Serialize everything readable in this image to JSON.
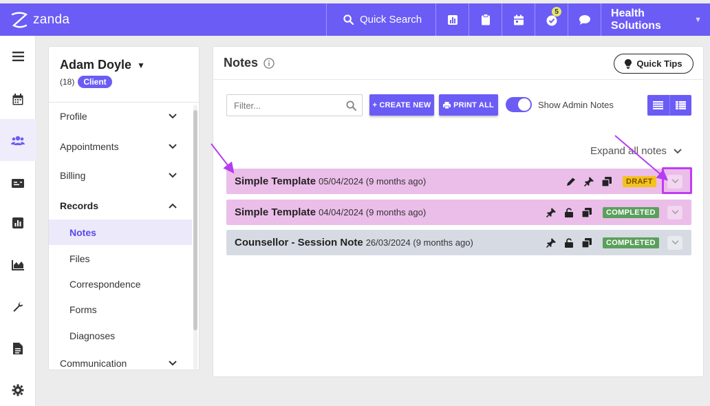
{
  "brand": {
    "name": "zanda",
    "accent": "#6b5cf6"
  },
  "topbar": {
    "search_label": "Quick Search",
    "icons": [
      "chart-icon",
      "clipboard-icon",
      "calendar-icon",
      "task-check-icon",
      "chat-icon"
    ],
    "task_badge": "5",
    "org_name": "Health Solutions"
  },
  "rail": {
    "items": [
      "menu-icon",
      "calendar-icon",
      "clients-icon",
      "billing-card-icon",
      "reports-icon",
      "analytics-icon",
      "tools-icon",
      "documents-icon",
      "settings-icon"
    ],
    "active": "clients-icon"
  },
  "client": {
    "name": "Adam Doyle",
    "count": "(18)",
    "type": "Client"
  },
  "side_menu": {
    "sections": [
      {
        "label": "Profile",
        "state": "collapsed"
      },
      {
        "label": "Appointments",
        "state": "collapsed"
      },
      {
        "label": "Billing",
        "state": "collapsed"
      },
      {
        "label": "Records",
        "state": "expanded"
      }
    ],
    "records_items": [
      "Notes",
      "Files",
      "Correspondence",
      "Forms",
      "Diagnoses"
    ],
    "active_item": "Notes",
    "communication": "Communication"
  },
  "main": {
    "title": "Notes",
    "quick_tips": "Quick Tips",
    "filter_placeholder": "Filter...",
    "create_new": "+ CREATE NEW",
    "print_all": "PRINT ALL",
    "show_admin_notes_label": "Show Admin Notes",
    "show_admin_notes_on": true,
    "expand_all": "Expand all notes"
  },
  "notes": [
    {
      "title": "Simple Template",
      "date": "05/04/2024 (9 months ago)",
      "status": "DRAFT",
      "color": "#ebbde9",
      "actions": [
        "edit-icon",
        "pin-icon",
        "copy-icon"
      ]
    },
    {
      "title": "Simple Template",
      "date": "04/04/2024 (9 months ago)",
      "status": "COMPLETED",
      "color": "#ebbde9",
      "actions": [
        "pin-icon",
        "unlock-icon",
        "copy-icon"
      ]
    },
    {
      "title": "Counsellor - Session Note",
      "date": "26/03/2024 (9 months ago)",
      "status": "COMPLETED",
      "color": "#d6dbe3",
      "actions": [
        "pin-icon",
        "unlock-icon",
        "copy-icon"
      ]
    }
  ],
  "colors": {
    "draft": "#f4c21c",
    "completed": "#5aa05c",
    "annotation": "#c03df2"
  }
}
